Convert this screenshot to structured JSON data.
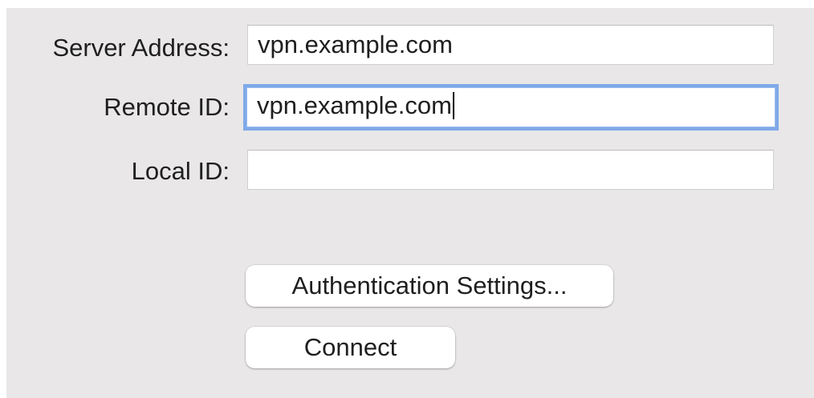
{
  "form": {
    "server_address": {
      "label": "Server Address:",
      "value": "vpn.example.com"
    },
    "remote_id": {
      "label": "Remote ID:",
      "value": "vpn.example.com"
    },
    "local_id": {
      "label": "Local ID:",
      "value": ""
    }
  },
  "buttons": {
    "authentication_settings": "Authentication Settings...",
    "connect": "Connect"
  },
  "colors": {
    "panel_background": "#e9e7e7",
    "focus_ring": "#7fa9e8"
  }
}
